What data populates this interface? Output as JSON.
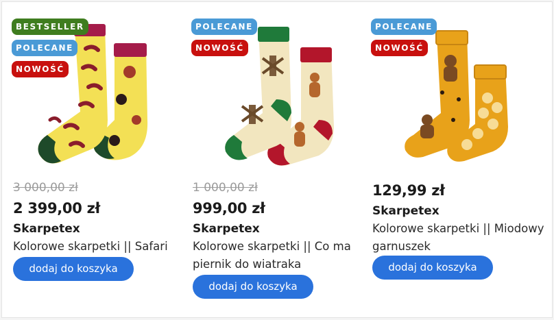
{
  "colors": {
    "bestseller": "#3f7d1f",
    "polecane": "#4a9ad6",
    "nowosc": "#c8100e",
    "button": "#2a72dc",
    "old_price": "#9b9b9b"
  },
  "products": [
    {
      "badges": [
        {
          "label": "BESTSELLER",
          "type": "bestseller"
        },
        {
          "label": "POLECANE",
          "type": "polecane"
        },
        {
          "label": "NOWOŚĆ",
          "type": "nowosc"
        }
      ],
      "image_icon": "safari-socks-image",
      "old_price": "3 000,00 zł",
      "price": "2 399,00 zł",
      "brand": "Skarpetex",
      "name": "Kolorowe skarpetki || Safari",
      "button_label": "dodaj do koszyka"
    },
    {
      "badges": [
        {
          "label": "POLECANE",
          "type": "polecane"
        },
        {
          "label": "NOWOŚĆ",
          "type": "nowosc"
        }
      ],
      "image_icon": "gingerbread-windmill-socks-image",
      "old_price": "1 000,00 zł",
      "price": "999,00 zł",
      "brand": "Skarpetex",
      "name": "Kolorowe skarpetki || Co ma piernik do wiatraka",
      "button_label": "dodaj do koszyka"
    },
    {
      "badges": [
        {
          "label": "POLECANE",
          "type": "polecane"
        },
        {
          "label": "NOWOŚĆ",
          "type": "nowosc"
        }
      ],
      "image_icon": "honey-bear-socks-image",
      "old_price": "",
      "price": "129,99 zł",
      "brand": "Skarpetex",
      "name": "Kolorowe skarpetki || Miodowy garnuszek",
      "button_label": "dodaj do koszyka"
    }
  ]
}
